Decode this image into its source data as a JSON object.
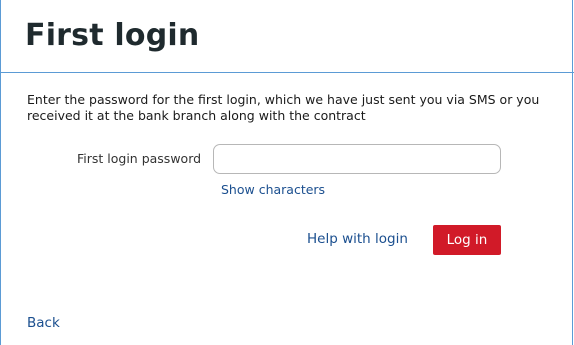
{
  "page": {
    "title": "First login",
    "instructions": "Enter the password for the first login, which we have just sent you via SMS or you received it at the bank branch along with the contract"
  },
  "form": {
    "password_label": "First login password",
    "password_value": "",
    "password_placeholder": "",
    "show_characters_label": "Show characters",
    "help_label": "Help with login",
    "login_button_label": "Log in"
  },
  "footer": {
    "back_label": "Back"
  },
  "colors": {
    "accent": "#d11a28",
    "link": "#1b4f8f",
    "frame_border": "#5b9bd5"
  }
}
